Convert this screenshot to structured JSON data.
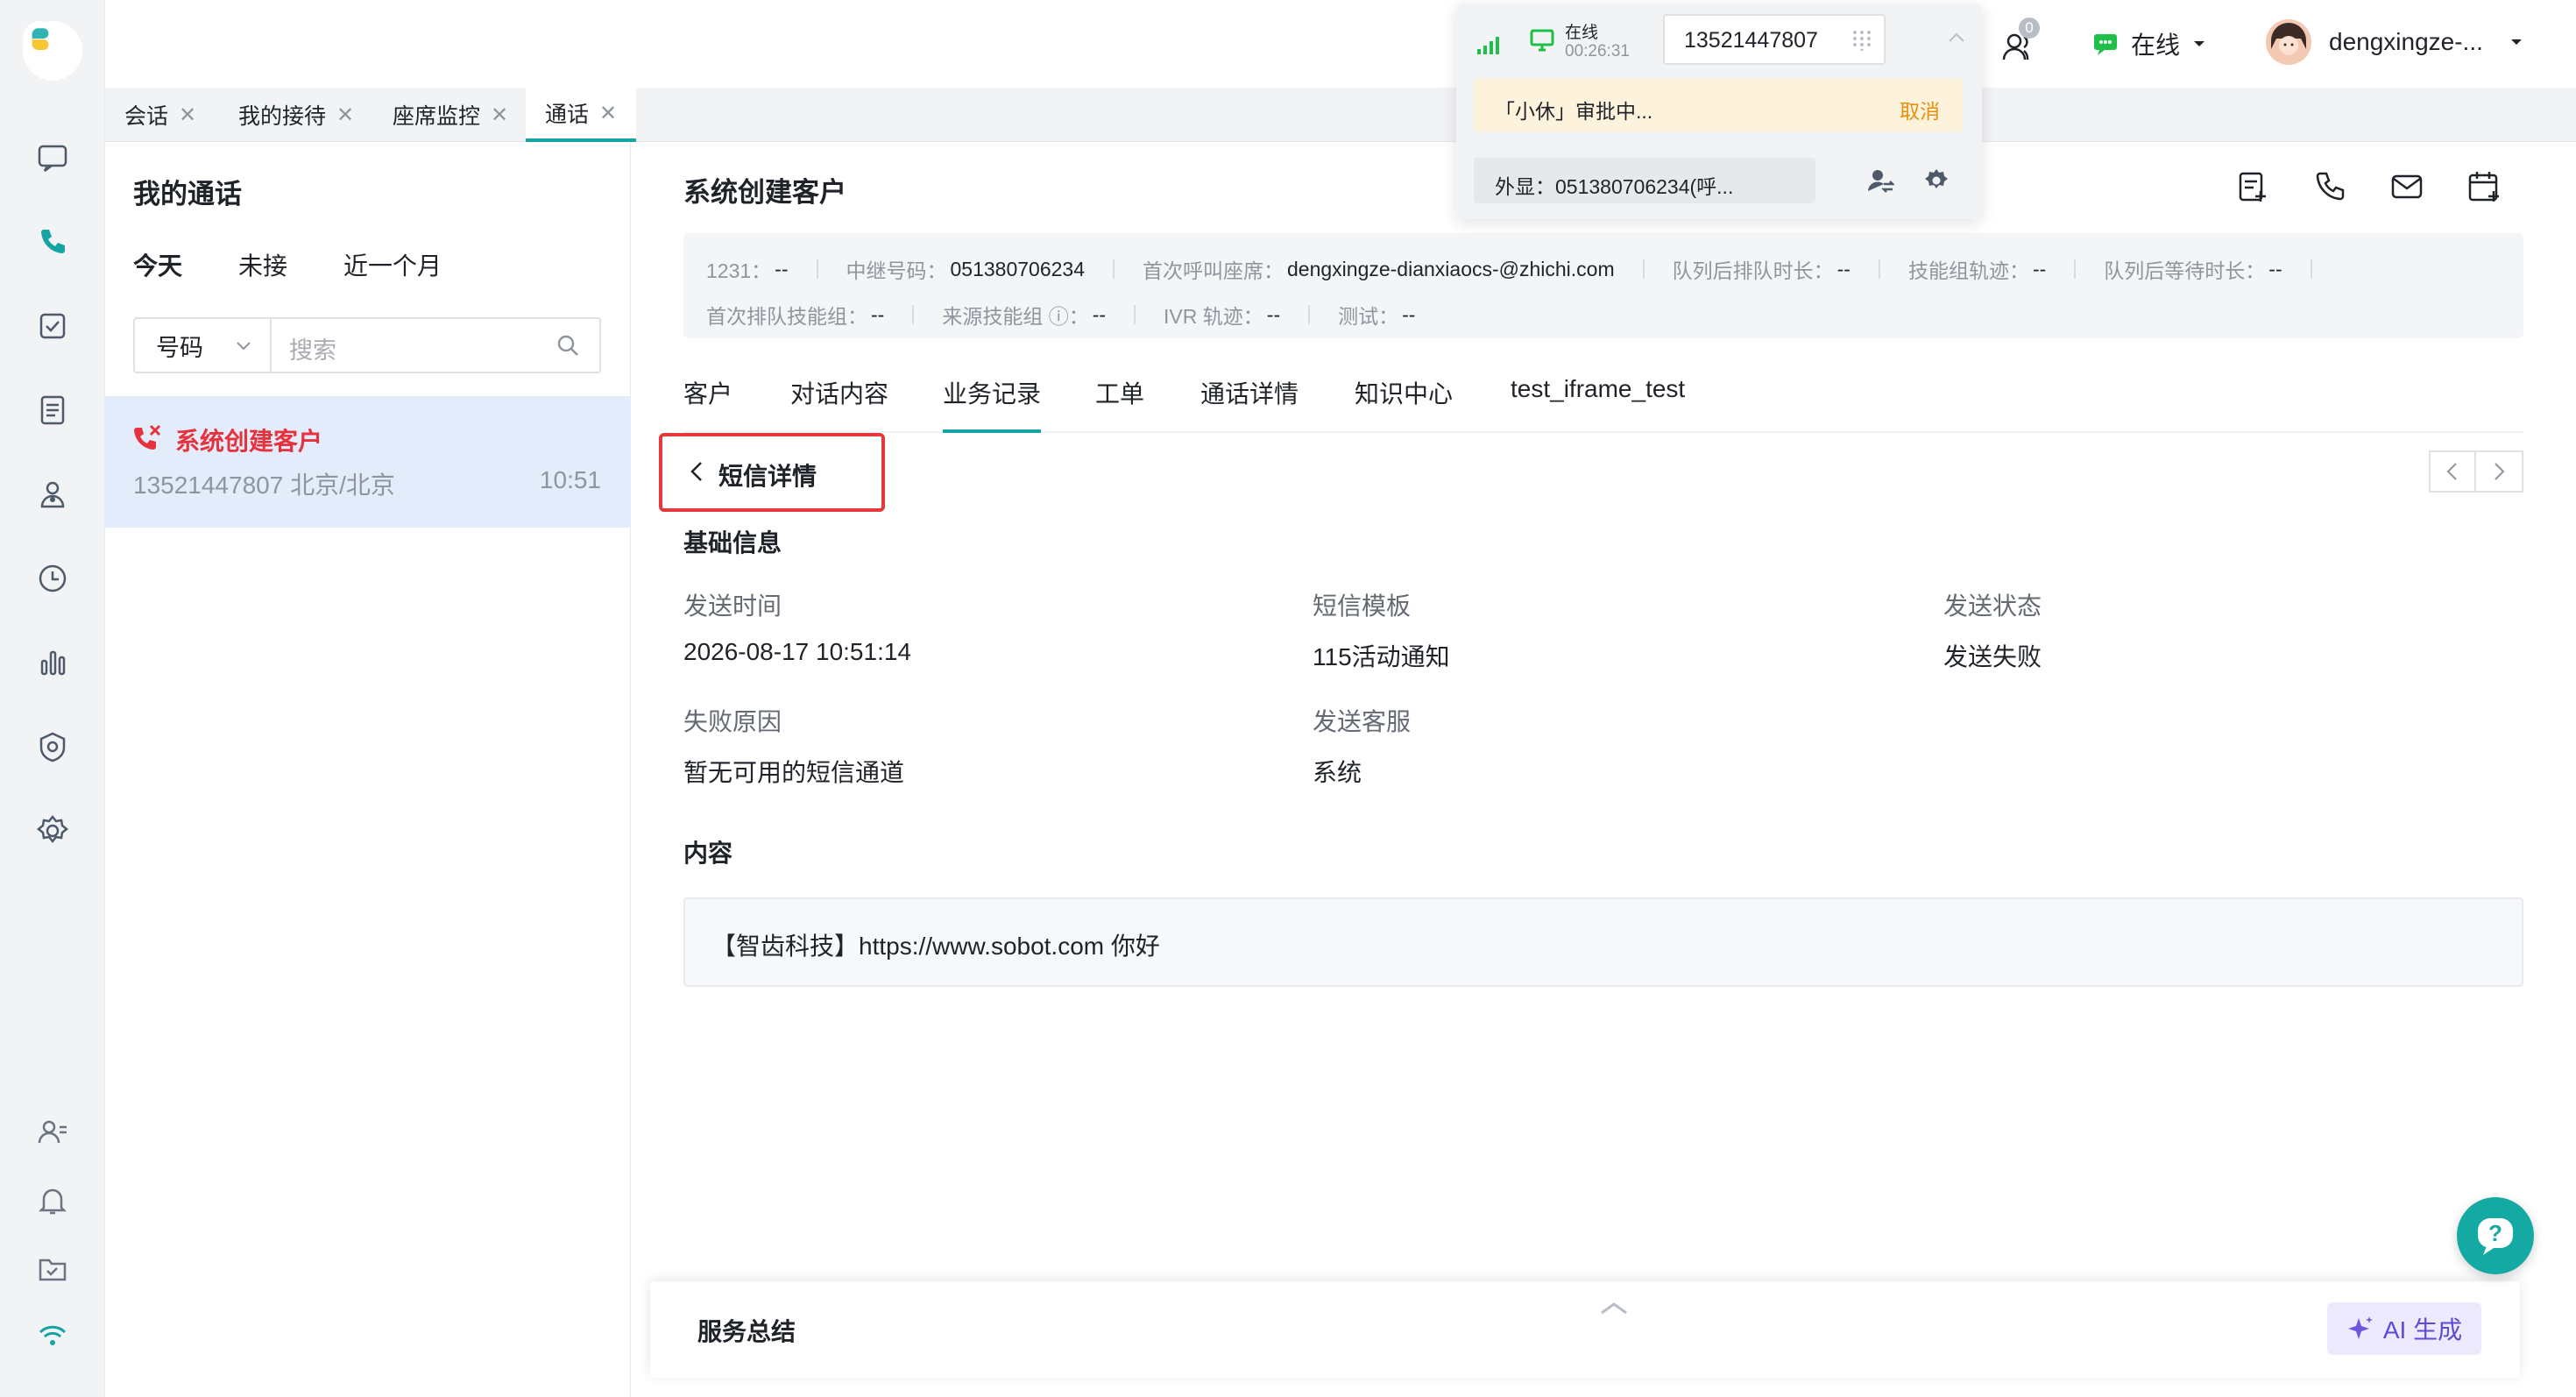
{
  "tabs": [
    {
      "label": "会话"
    },
    {
      "label": "我的接待"
    },
    {
      "label": "座席监控"
    },
    {
      "label": "通话"
    }
  ],
  "active_tab": "通话",
  "left_panel": {
    "title": "我的通话",
    "filters": [
      "今天",
      "未接",
      "近一个月"
    ],
    "search": {
      "type": "号码",
      "placeholder": "搜索"
    },
    "call_item": {
      "name": "系统创建客户",
      "phone_location": "13521447807 北京/北京",
      "time": "10:51"
    }
  },
  "main": {
    "title": "系统创建客户",
    "info": {
      "row1": [
        {
          "k": "1231：",
          "v": "--"
        },
        {
          "k": "中继号码：",
          "v": "051380706234"
        },
        {
          "k": "首次呼叫座席：",
          "v": "dengxingze-dianxiaocs-@zhichi.com"
        },
        {
          "k": "队列后排队时长：",
          "v": "--"
        },
        {
          "k": "技能组轨迹：",
          "v": "--"
        },
        {
          "k": "队列后等待时长：",
          "v": "--"
        }
      ],
      "row2": [
        {
          "k": "首次排队技能组：",
          "v": "--"
        },
        {
          "k": "来源技能组 ⓘ：",
          "v": "--"
        },
        {
          "k": "IVR 轨迹：",
          "v": "--"
        },
        {
          "k": "测试：",
          "v": "--"
        }
      ]
    },
    "tabs": [
      "客户",
      "对话内容",
      "业务记录",
      "工单",
      "通话详情",
      "知识中心",
      "test_iframe_test"
    ],
    "active_tab": "业务记录",
    "back_label": "短信详情",
    "basic_info_label": "基础信息",
    "fields": [
      {
        "k": "发送时间",
        "v": "2026-08-17 10:51:14"
      },
      {
        "k": "短信模板",
        "v": "115活动通知"
      },
      {
        "k": "发送状态",
        "v": "发送失败"
      },
      {
        "k": "失败原因",
        "v": "暂无可用的短信通道"
      },
      {
        "k": "发送客服",
        "v": "系统"
      }
    ],
    "content_label": "内容",
    "content_text": "【智齿科技】https://www.sobot.com 你好"
  },
  "summary": {
    "title": "服务总结",
    "ai_label": "AI 生成"
  },
  "popup": {
    "status": "在线",
    "timer": "00:26:31",
    "number": "13521447807",
    "approval": "「小休」审批中...",
    "cancel": "取消",
    "display": "外显：051380706234(呼..."
  },
  "header": {
    "agent_count": "0",
    "online_status": "在线",
    "user_name": "dengxingze-..."
  },
  "colors": {
    "accent": "#16a3a3",
    "missed": "#e5323c",
    "highlight_box": "#e5383b"
  }
}
